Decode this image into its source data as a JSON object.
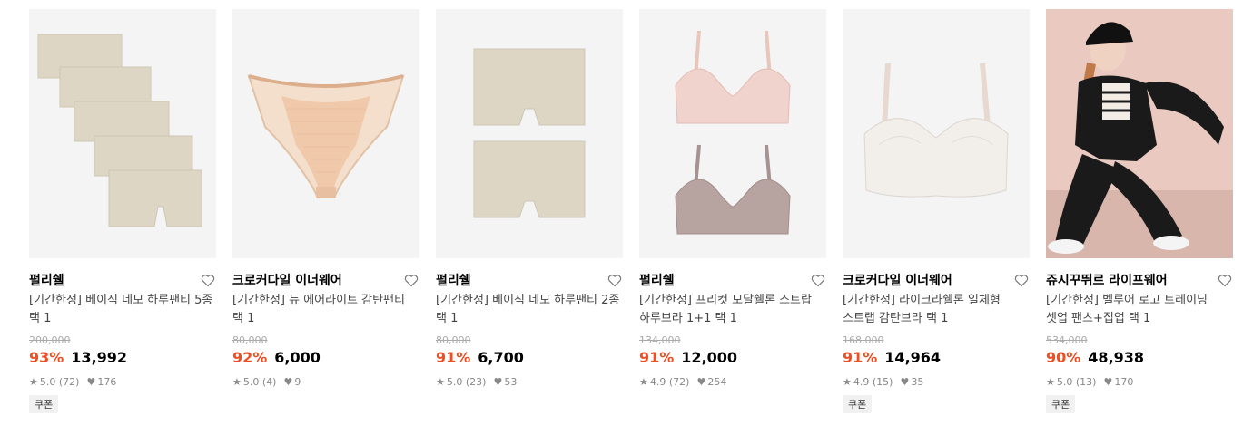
{
  "colors": {
    "accent": "#f04e23",
    "strike": "#aaaaaa",
    "meta": "#888888",
    "image_bg": "#f4f4f4"
  },
  "products": [
    {
      "brand": "펄리쉘",
      "name": "[기간한정] 베이직 네모 하루팬티 5종 택 1",
      "original_price": "200,000",
      "discount": "93%",
      "price": "13,992",
      "rating": "5.0 (72)",
      "likes": "176",
      "coupon": "쿠폰",
      "image_icon": "beige-boxer-briefs-stack"
    },
    {
      "brand": "크로커다일 이너웨어",
      "name": "[기간한정] 뉴 에어라이트 감탄팬티 택 1",
      "original_price": "80,000",
      "discount": "92%",
      "price": "6,000",
      "rating": "5.0 (4)",
      "likes": "9",
      "coupon": "",
      "image_icon": "peach-lace-panty"
    },
    {
      "brand": "펄리쉘",
      "name": "[기간한정] 베이직 네모 하루팬티 2종 택 1",
      "original_price": "80,000",
      "discount": "91%",
      "price": "6,700",
      "rating": "5.0 (23)",
      "likes": "53",
      "coupon": "",
      "image_icon": "beige-boxer-briefs-pair"
    },
    {
      "brand": "펄리쉘",
      "name": "[기간한정] 프리컷 모달쉘론 스트랍 하루브라 1+1 택 1",
      "original_price": "134,000",
      "discount": "91%",
      "price": "12,000",
      "rating": "4.9 (72)",
      "likes": "254",
      "coupon": "",
      "image_icon": "pink-and-mauve-bralettes"
    },
    {
      "brand": "크로커다일 이너웨어",
      "name": "[기간한정] 라이크라쉘론 일체형 스트랩 감탄브라 택 1",
      "original_price": "168,000",
      "discount": "91%",
      "price": "14,964",
      "rating": "4.9 (15)",
      "likes": "35",
      "coupon": "쿠폰",
      "image_icon": "ivory-seamless-bra"
    },
    {
      "brand": "쥬시꾸뛰르 라이프웨어",
      "name": "[기간한정] 벨루어 로고 트레이닝 셋업 팬츠+집업 택 1",
      "original_price": "534,000",
      "discount": "90%",
      "price": "48,938",
      "rating": "5.0 (13)",
      "likes": "170",
      "coupon": "쿠폰",
      "image_icon": "model-black-velour-tracksuit"
    }
  ]
}
